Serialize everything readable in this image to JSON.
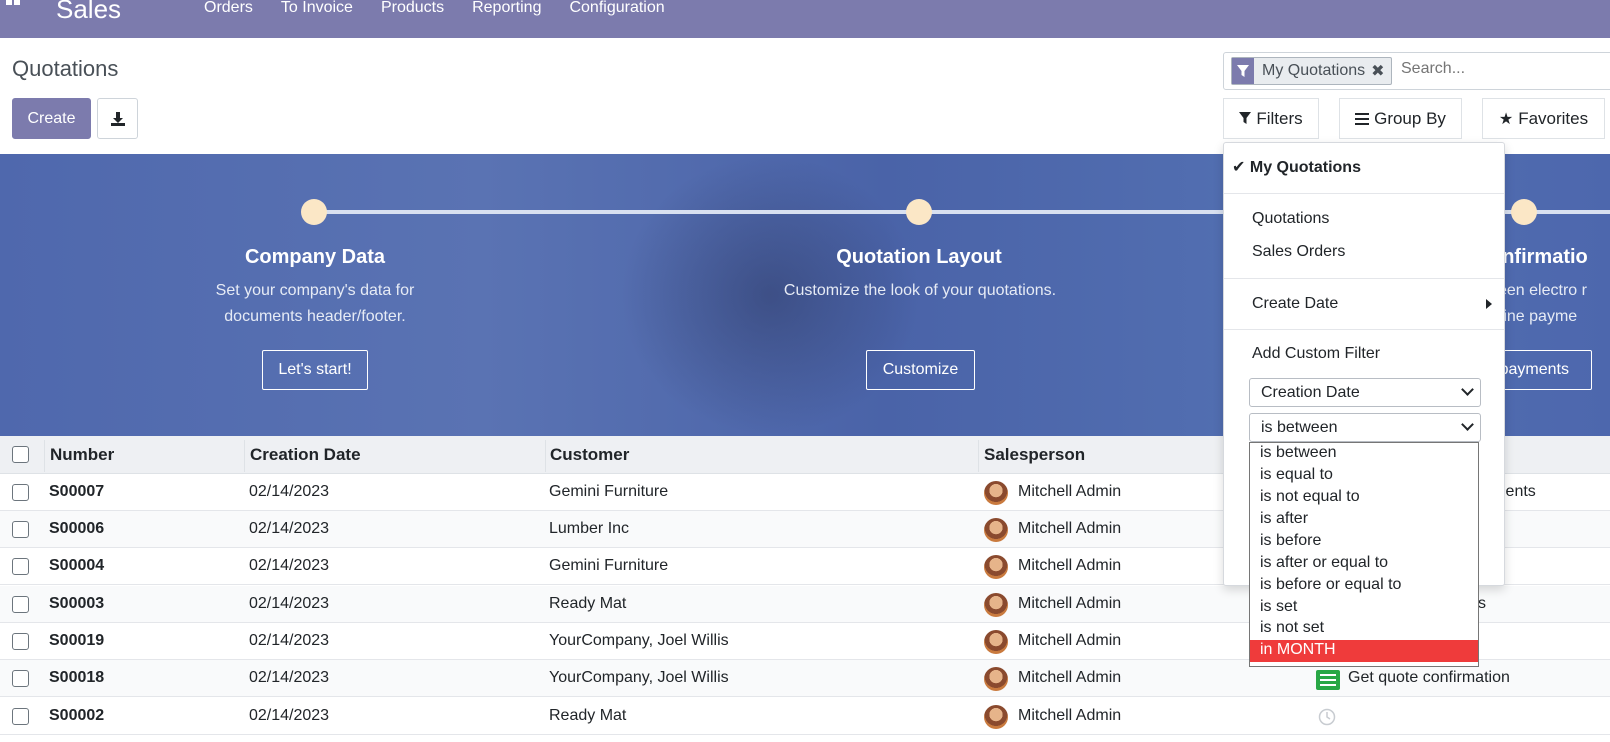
{
  "navbar": {
    "app_name": "Sales",
    "menu": [
      "Orders",
      "To Invoice",
      "Products",
      "Reporting",
      "Configuration"
    ]
  },
  "control_panel": {
    "title": "Quotations",
    "create_label": "Create",
    "facet_label": "My Quotations",
    "search_placeholder": "Search...",
    "filters_label": "Filters",
    "groupby_label": "Group By",
    "favorites_label": "Favorites"
  },
  "banner": {
    "steps": [
      {
        "title": "Company Data",
        "desc": "Set your company's data for documents header/footer.",
        "button": "Let's start!"
      },
      {
        "title": "Quotation Layout",
        "desc": "Customize the look of your quotations.",
        "button": "Customize"
      },
      {
        "title": "onfirmatio",
        "desc": "tween electro r online payme",
        "button": "payments"
      }
    ]
  },
  "table": {
    "columns": [
      "Number",
      "Creation Date",
      "Customer",
      "Salesperson"
    ],
    "rows": [
      {
        "number": "S00007",
        "date": "02/14/2023",
        "customer": "Gemini Furniture",
        "salesperson": "Mitchell Admin",
        "activity": "rements"
      },
      {
        "number": "S00006",
        "date": "02/14/2023",
        "customer": "Lumber Inc",
        "salesperson": "Mitchell Admin",
        "activity": ""
      },
      {
        "number": "S00004",
        "date": "02/14/2023",
        "customer": "Gemini Furniture",
        "salesperson": "Mitchell Admin",
        "activity": ""
      },
      {
        "number": "S00003",
        "date": "02/14/2023",
        "customer": "Ready Mat",
        "salesperson": "Mitchell Admin",
        "activity": "s"
      },
      {
        "number": "S00019",
        "date": "02/14/2023",
        "customer": "YourCompany, Joel Willis",
        "salesperson": "Mitchell Admin",
        "activity": ""
      },
      {
        "number": "S00018",
        "date": "02/14/2023",
        "customer": "YourCompany, Joel Willis",
        "salesperson": "Mitchell Admin",
        "activity": "Get quote confirmation"
      },
      {
        "number": "S00002",
        "date": "02/14/2023",
        "customer": "Ready Mat",
        "salesperson": "Mitchell Admin",
        "activity": ""
      }
    ]
  },
  "filter_dropdown": {
    "my_quotations": "My Quotations",
    "quotations": "Quotations",
    "sales_orders": "Sales Orders",
    "create_date": "Create Date",
    "add_custom_filter": "Add Custom Filter",
    "field_select": "Creation Date",
    "operator_select": "is between",
    "operator_options": [
      "is between",
      "is equal to",
      "is not equal to",
      "is after",
      "is before",
      "is after or equal to",
      "is before or equal to",
      "is set",
      "is not set",
      "in MONTH"
    ],
    "highlighted_option": "in MONTH"
  },
  "colors": {
    "brand": "#7c7bad",
    "banner": "#5a73b3",
    "highlight": "#ef3b3b",
    "activity_green": "#28a745"
  }
}
